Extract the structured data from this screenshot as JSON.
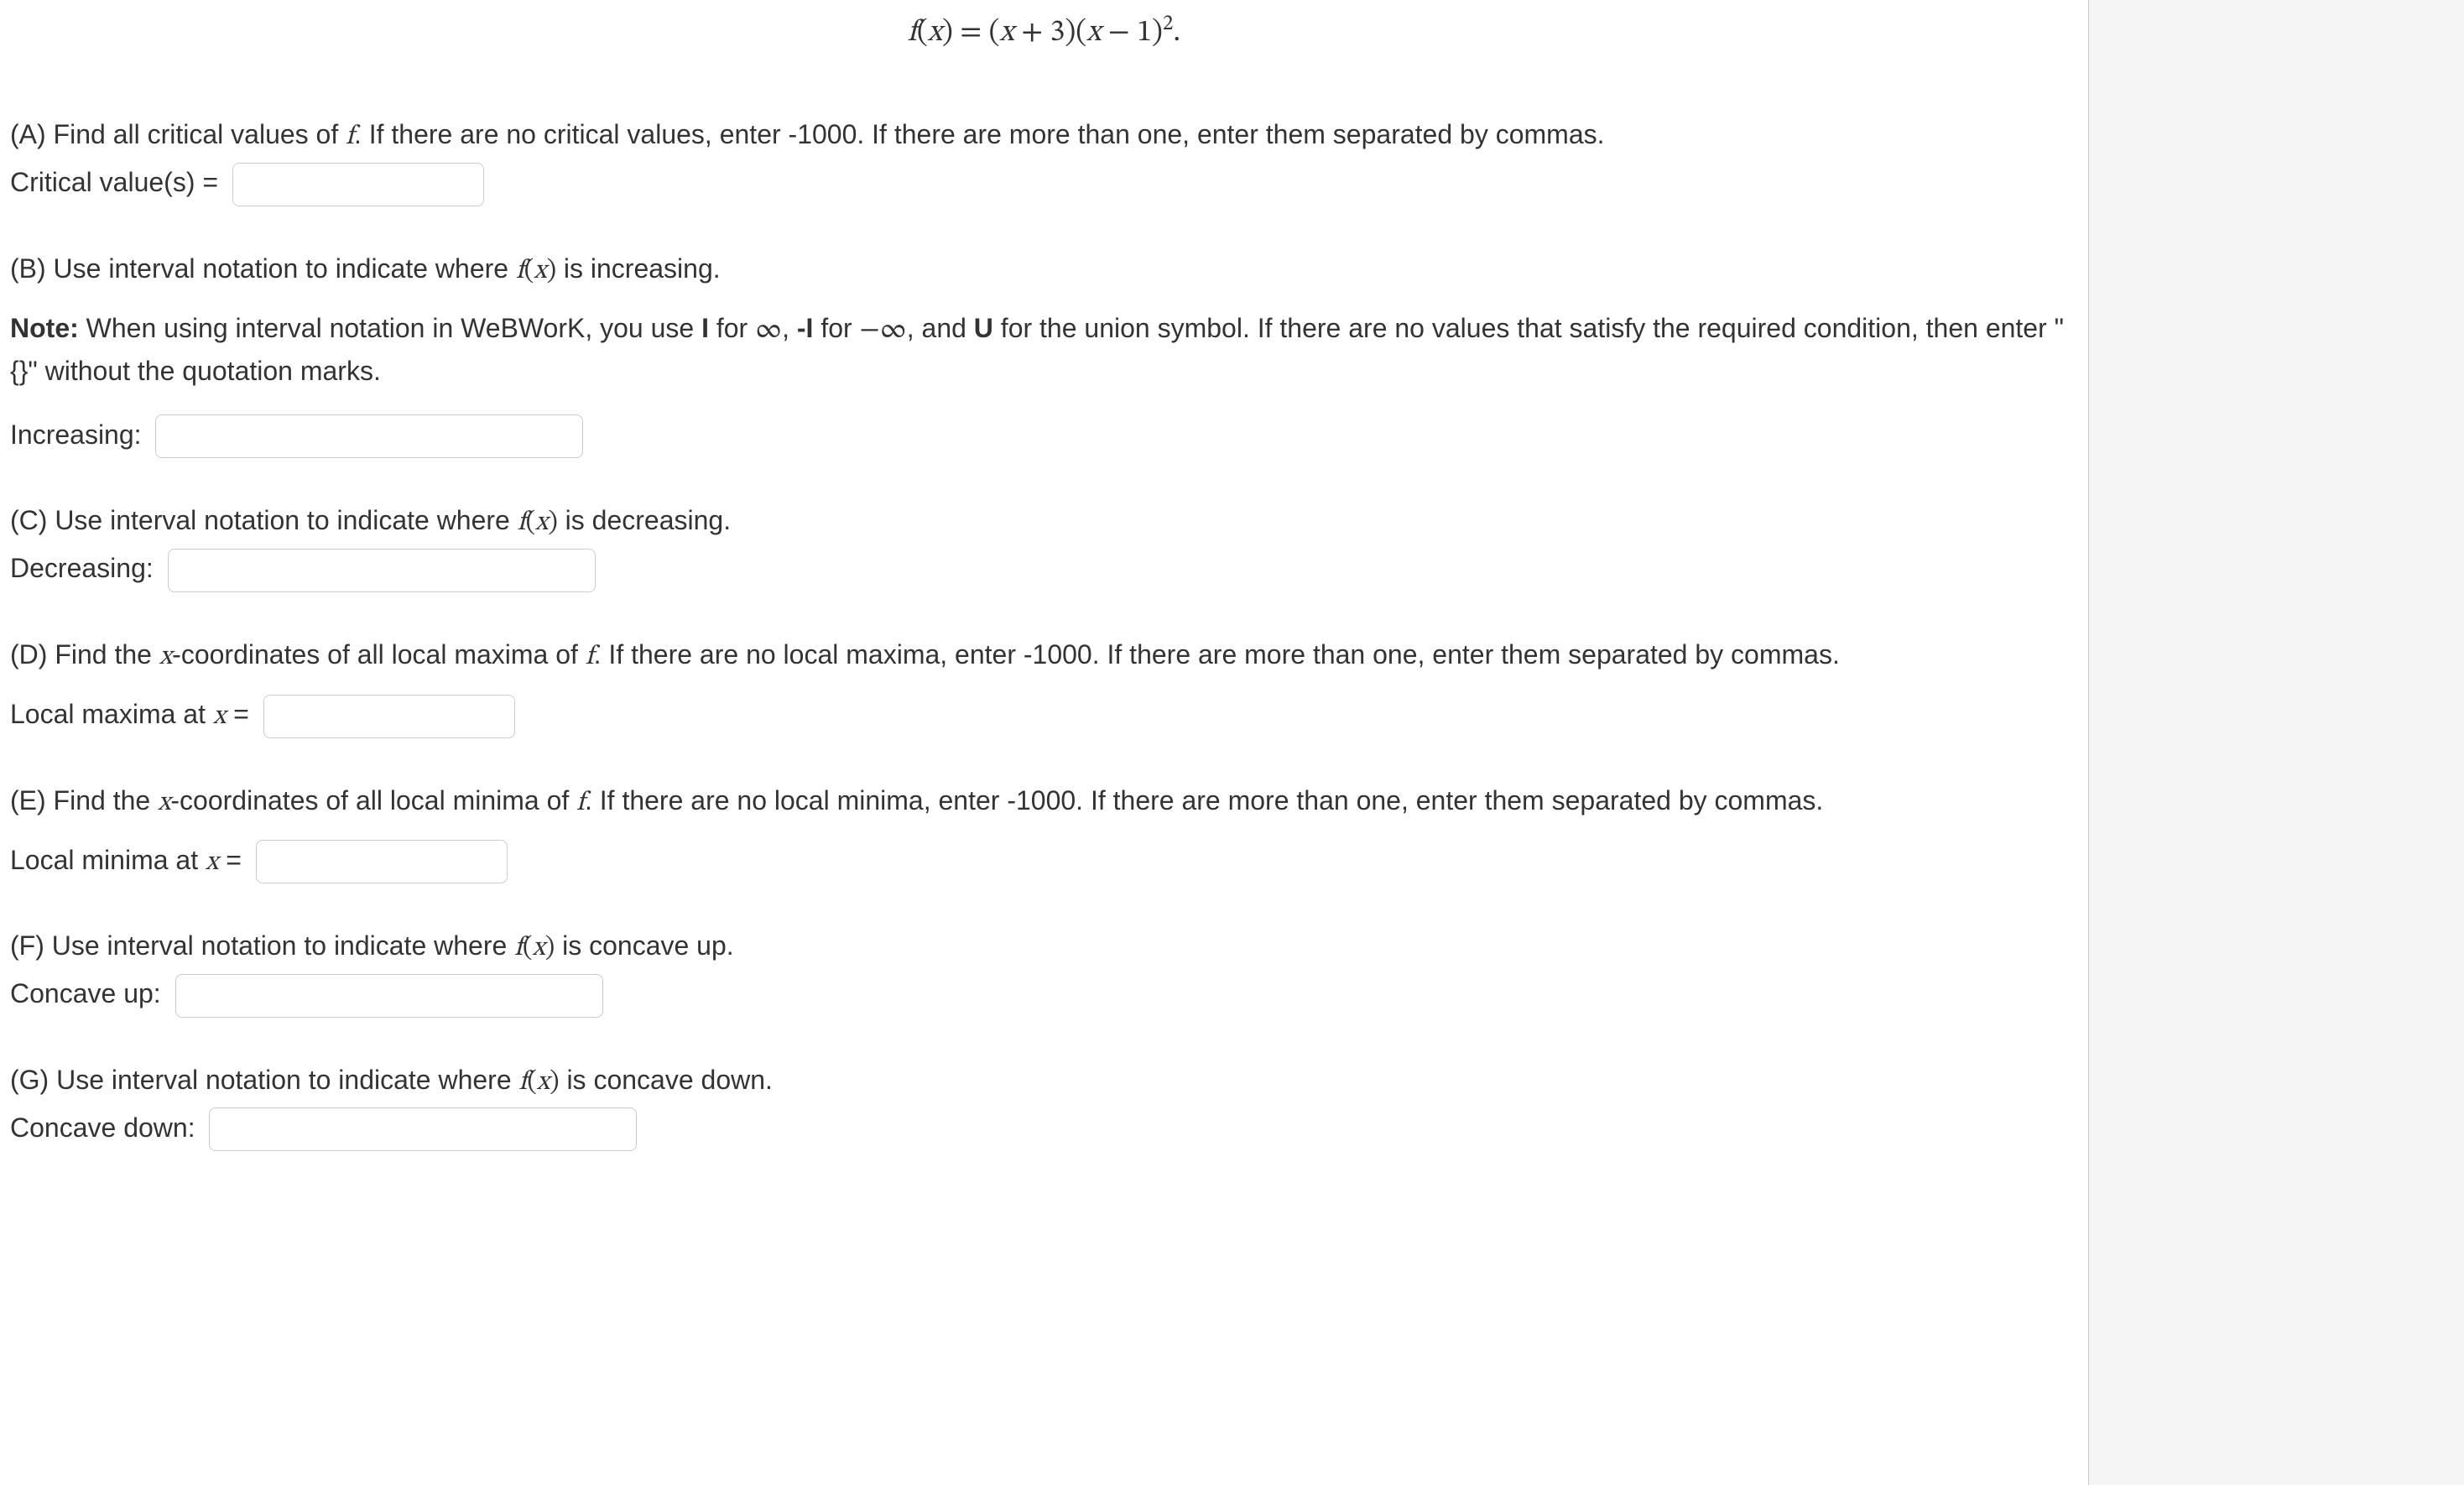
{
  "equation_html": "<span class='ital'>f</span>(<span class='ital'>x</span>) = (<span class='ital'>x</span> + 3)(<span class='ital'>x</span> − 1)<sup>2</sup>.",
  "partA": {
    "prompt_prefix": "(A) Find all critical values of ",
    "prompt_f": "f",
    "prompt_suffix": ". If there are no critical values, enter -1000. If there are more than one, enter them separated by commas.",
    "label": "Critical value(s) ="
  },
  "partB": {
    "prompt_prefix": "(B) Use interval notation to indicate where ",
    "prompt_fx": "f(x)",
    "prompt_suffix": " is increasing.",
    "note_bold": "Note:",
    "note_seg1": " When using interval notation in WeBWorK, you use ",
    "note_I": "I",
    "note_seg2": " for ",
    "note_inf": "∞",
    "note_seg3": ", ",
    "note_negI": "-I",
    "note_seg4": " for ",
    "note_neginf": "−∞",
    "note_seg5": ", and ",
    "note_U": "U",
    "note_seg6": " for the union symbol. If there are no values that satisfy the required condition, then enter \"{}\" without the quotation marks.",
    "label": "Increasing:"
  },
  "partC": {
    "prompt_prefix": "(C) Use interval notation to indicate where ",
    "prompt_fx": "f(x)",
    "prompt_suffix": " is decreasing.",
    "label": "Decreasing:"
  },
  "partD": {
    "prompt_prefix": "(D) Find the ",
    "prompt_x": "x",
    "prompt_mid": "-coordinates of all local maxima of ",
    "prompt_f": "f",
    "prompt_suffix": ". If there are no local maxima, enter -1000. If there are more than one, enter them separated by commas.",
    "label_prefix": "Local maxima at ",
    "label_x": "x",
    "label_suffix": " ="
  },
  "partE": {
    "prompt_prefix": "(E) Find the ",
    "prompt_x": "x",
    "prompt_mid": "-coordinates of all local minima of ",
    "prompt_f": "f",
    "prompt_suffix": ". If there are no local minima, enter -1000. If there are more than one, enter them separated by commas.",
    "label_prefix": "Local minima at ",
    "label_x": "x",
    "label_suffix": " ="
  },
  "partF": {
    "prompt_prefix": "(F) Use interval notation to indicate where ",
    "prompt_fx": "f(x)",
    "prompt_suffix": " is concave up.",
    "label": "Concave up:"
  },
  "partG": {
    "prompt_prefix": "(G) Use interval notation to indicate where ",
    "prompt_fx": "f(x)",
    "prompt_suffix": " is concave down.",
    "label": "Concave down:"
  }
}
